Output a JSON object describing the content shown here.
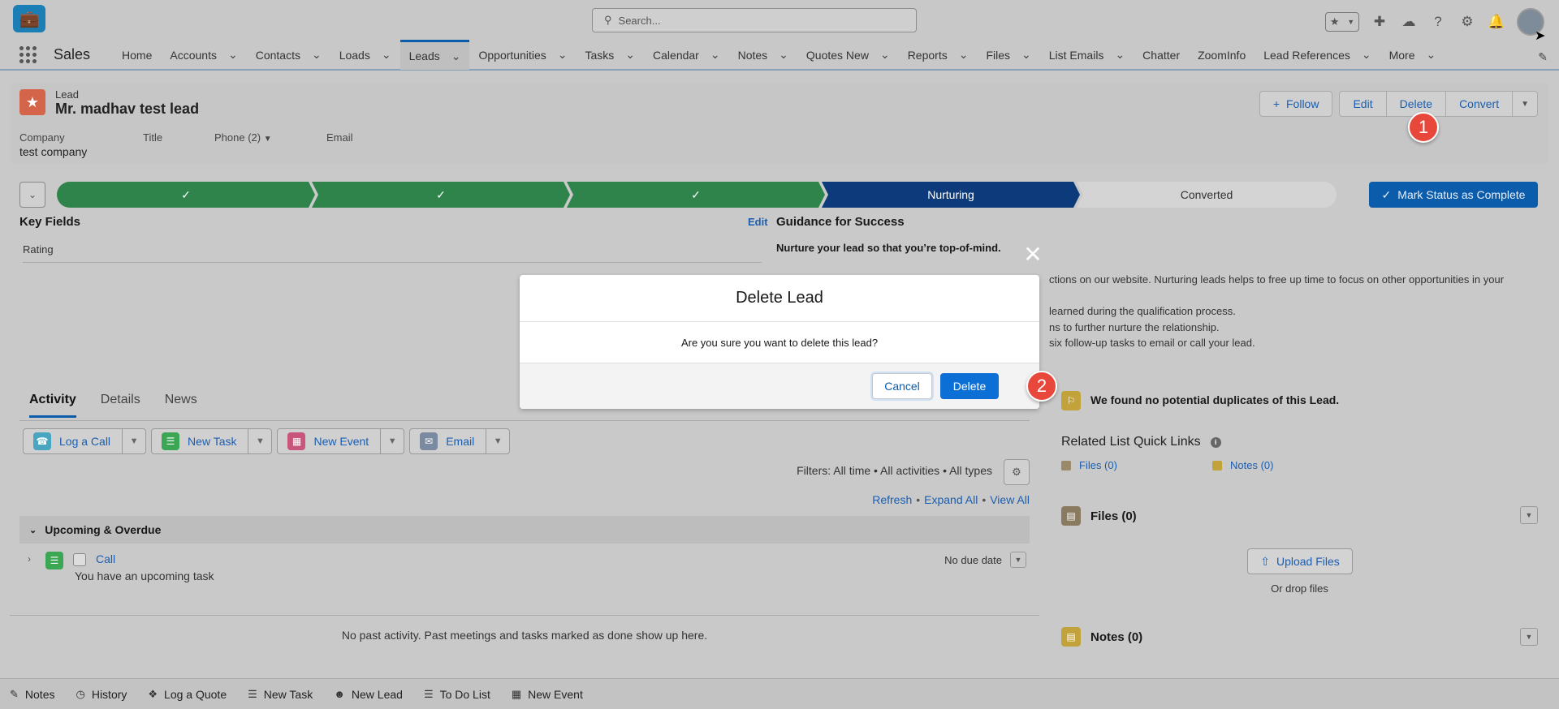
{
  "header": {
    "search_placeholder": "Search...",
    "icons": [
      "favorites-icon",
      "add-icon",
      "trailhead-icon",
      "help-icon",
      "setup-icon",
      "notifications-icon",
      "avatar"
    ]
  },
  "nav": {
    "app_name": "Sales",
    "items": [
      {
        "label": "Home",
        "dropdown": false
      },
      {
        "label": "Accounts",
        "dropdown": true
      },
      {
        "label": "Contacts",
        "dropdown": true
      },
      {
        "label": "Loads",
        "dropdown": true
      },
      {
        "label": "Leads",
        "dropdown": true,
        "active": true
      },
      {
        "label": "Opportunities",
        "dropdown": true
      },
      {
        "label": "Tasks",
        "dropdown": true
      },
      {
        "label": "Calendar",
        "dropdown": true
      },
      {
        "label": "Notes",
        "dropdown": true
      },
      {
        "label": "Quotes New",
        "dropdown": true
      },
      {
        "label": "Reports",
        "dropdown": true
      },
      {
        "label": "Files",
        "dropdown": true
      },
      {
        "label": "List Emails",
        "dropdown": true
      },
      {
        "label": "Chatter",
        "dropdown": false
      },
      {
        "label": "ZoomInfo",
        "dropdown": false
      },
      {
        "label": "Lead References",
        "dropdown": true
      },
      {
        "label": "More",
        "dropdown": true
      }
    ]
  },
  "record": {
    "type": "Lead",
    "name": "Mr. madhav test lead",
    "actions": {
      "follow": "Follow",
      "edit": "Edit",
      "delete": "Delete",
      "convert": "Convert"
    },
    "fields": [
      {
        "label": "Company",
        "value": "test company"
      },
      {
        "label": "Title",
        "value": ""
      },
      {
        "label": "Phone (2)",
        "value": ""
      },
      {
        "label": "Email",
        "value": ""
      }
    ]
  },
  "path": {
    "stages": [
      {
        "label": "✓",
        "state": "done"
      },
      {
        "label": "✓",
        "state": "done"
      },
      {
        "label": "✓",
        "state": "done"
      },
      {
        "label": "Nurturing",
        "state": "current"
      },
      {
        "label": "Converted",
        "state": "todo"
      }
    ],
    "mark_button": "Mark Status as Complete",
    "key_fields_title": "Key Fields",
    "edit_label": "Edit",
    "rating_label": "Rating",
    "guidance_title": "Guidance for Success",
    "guidance_sub": "Nurture your lead so that you’re top-of-mind.",
    "guidance_lines": [
      "ctions on our website. Nurturing leads helps to free up time to focus on other opportunities in your",
      "learned during the qualification process.",
      "ns to further nurture the relationship.",
      "six follow-up tasks to email or call your lead."
    ]
  },
  "activity": {
    "tabs": [
      "Activity",
      "Details",
      "News"
    ],
    "publishers": [
      "Log a Call",
      "New Task",
      "New Event",
      "Email"
    ],
    "filters": "Filters: All time • All activities • All types",
    "links": [
      "Refresh",
      "Expand All",
      "View All"
    ],
    "upcoming_title": "Upcoming & Overdue",
    "task": {
      "name": "Call",
      "subtitle": "You have an upcoming task",
      "due": "No due date"
    },
    "no_past": "No past activity. Past meetings and tasks marked as done show up here."
  },
  "sidebar": {
    "duplicates": "We found no potential duplicates of this Lead.",
    "related_title": "Related List Quick Links",
    "related_links": [
      "Files (0)",
      "Notes (0)"
    ],
    "files_title": "Files (0)",
    "upload_label": "Upload Files",
    "drop_label": "Or drop files",
    "notes_title": "Notes (0)"
  },
  "utility": [
    "Notes",
    "History",
    "Log a Quote",
    "New Task",
    "New Lead",
    "To Do List",
    "New Event"
  ],
  "modal": {
    "title": "Delete Lead",
    "message": "Are you sure you want to delete this lead?",
    "cancel": "Cancel",
    "delete": "Delete"
  },
  "steps": [
    "1",
    "2"
  ],
  "colors": {
    "brand": "#0b5cab",
    "path_done": "#2e844a",
    "path_current": "#0d3a7a",
    "badge": "#e8483b"
  }
}
